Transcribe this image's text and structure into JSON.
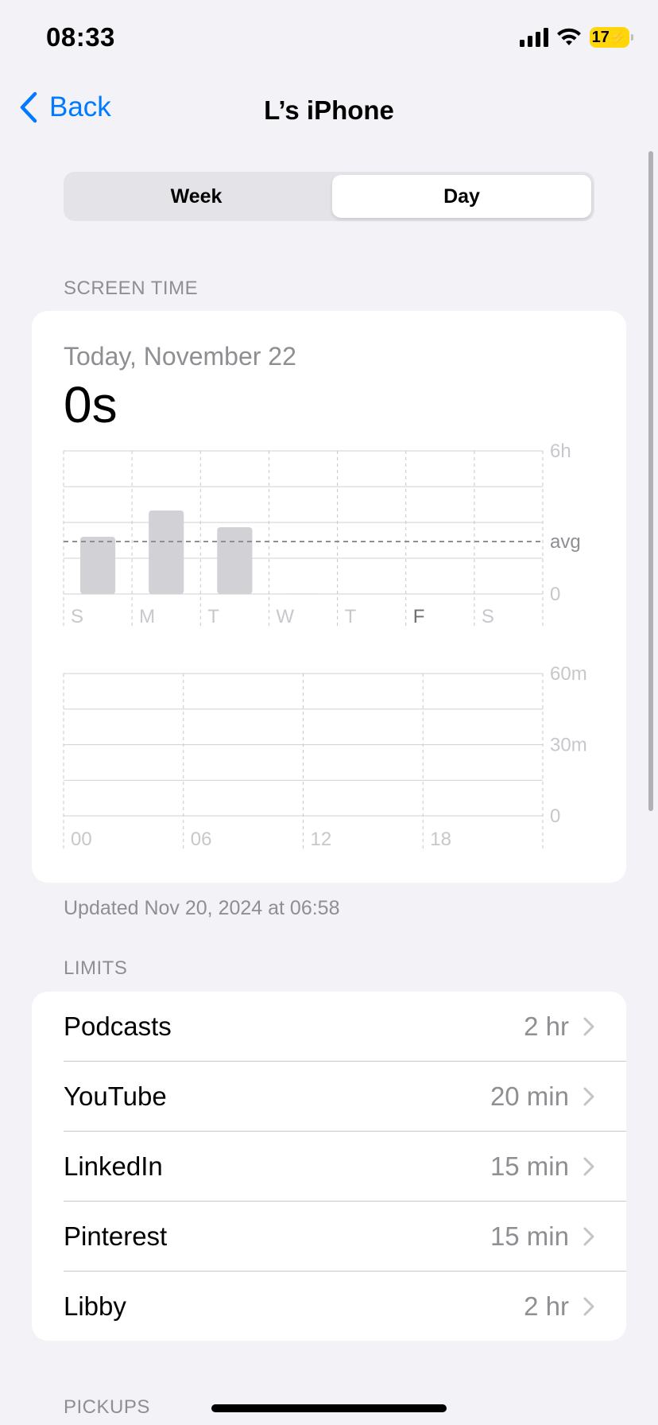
{
  "status_bar": {
    "time": "08:33",
    "battery": "17"
  },
  "nav": {
    "back_label": "Back",
    "title": "L’s iPhone"
  },
  "segmented": {
    "week_label": "Week",
    "day_label": "Day",
    "selected": "Day"
  },
  "screen_time": {
    "section_header": "SCREEN TIME",
    "date_label": "Today, November 22",
    "total": "0s",
    "updated": "Updated Nov 20, 2024 at 06:58"
  },
  "chart_data": [
    {
      "type": "bar",
      "categories": [
        "S",
        "M",
        "T",
        "W",
        "T",
        "F",
        "S"
      ],
      "values": [
        2.4,
        3.5,
        2.8,
        0.02,
        0,
        0,
        0
      ],
      "ylim": [
        0,
        6
      ],
      "y_ticks": [
        "6h",
        "avg",
        "0"
      ],
      "average": 2.2,
      "highlighted_category_index": 5,
      "grid": true
    },
    {
      "type": "bar",
      "categories": [
        "00",
        "06",
        "12",
        "18"
      ],
      "values": [],
      "ylim": [
        0,
        60
      ],
      "y_ticks": [
        "60m",
        "30m",
        "0"
      ],
      "grid": true
    }
  ],
  "limits": {
    "section_header": "LIMITS",
    "items": [
      {
        "name": "Podcasts",
        "value": "2 hr"
      },
      {
        "name": "YouTube",
        "value": "20 min"
      },
      {
        "name": "LinkedIn",
        "value": "15 min"
      },
      {
        "name": "Pinterest",
        "value": "15 min"
      },
      {
        "name": "Libby",
        "value": "2 hr"
      }
    ]
  },
  "pickups": {
    "section_header": "PICKUPS"
  }
}
